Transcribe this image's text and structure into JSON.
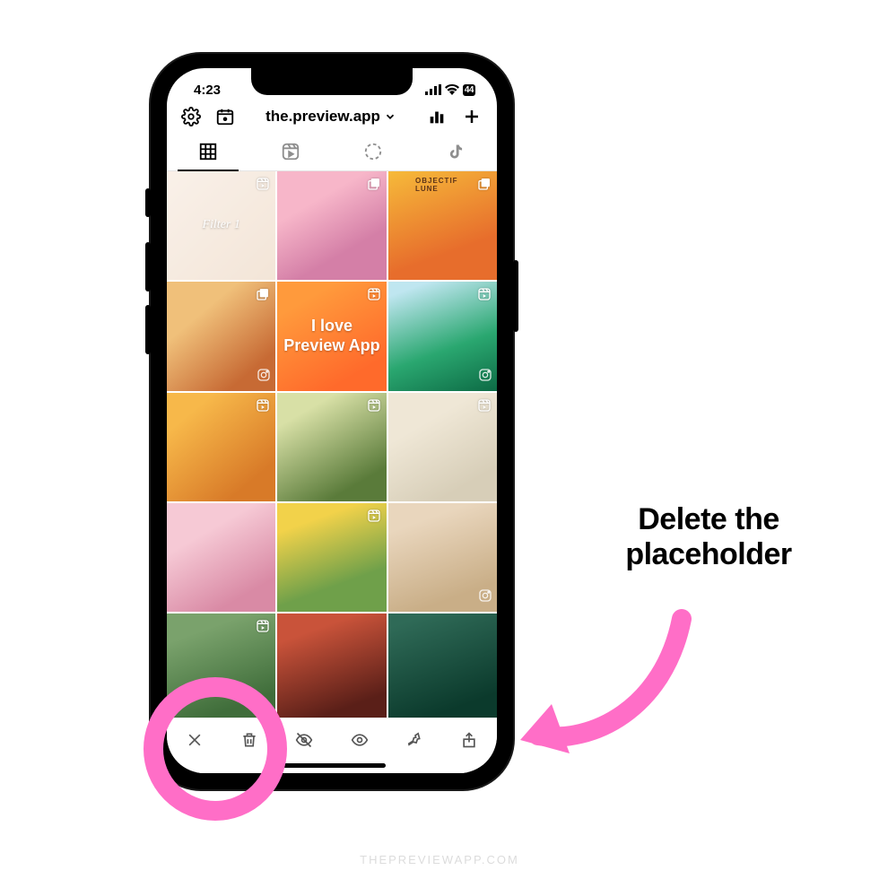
{
  "status": {
    "time": "4:23",
    "battery": "44"
  },
  "topbar": {
    "settings_icon": "settings",
    "calendar_icon": "calendar",
    "account": "the.preview.app",
    "analytics_icon": "analytics",
    "add_icon": "add"
  },
  "tabs": [
    {
      "name": "grid",
      "active": true
    },
    {
      "name": "reels",
      "active": false
    },
    {
      "name": "stories",
      "active": false
    },
    {
      "name": "tiktok",
      "active": false
    }
  ],
  "grid": [
    {
      "badge": "reel",
      "label": "Filter 1",
      "label_style": "italic",
      "selected": true,
      "bg": "bg-a"
    },
    {
      "badge": "carousel",
      "label": "",
      "label_style": "",
      "selected": false,
      "bg": "bg-b"
    },
    {
      "badge": "carousel",
      "label": "",
      "label_style": "",
      "selected": false,
      "bg": "bg-c"
    },
    {
      "badge": "carousel",
      "label": "",
      "label_style": "",
      "selected": false,
      "bg": "bg-d",
      "ig": true
    },
    {
      "badge": "reel",
      "label": "I love Preview App",
      "label_style": "bold",
      "selected": false,
      "bg": "bg-e"
    },
    {
      "badge": "reel",
      "label": "",
      "label_style": "",
      "selected": false,
      "bg": "bg-f",
      "ig": true
    },
    {
      "badge": "reel",
      "label": "",
      "label_style": "",
      "selected": false,
      "bg": "bg-g"
    },
    {
      "badge": "reel",
      "label": "",
      "label_style": "",
      "selected": false,
      "bg": "bg-h"
    },
    {
      "badge": "reel",
      "label": "",
      "label_style": "",
      "selected": false,
      "bg": "bg-i"
    },
    {
      "badge": "",
      "label": "",
      "label_style": "",
      "selected": false,
      "bg": "bg-j"
    },
    {
      "badge": "reel",
      "label": "",
      "label_style": "",
      "selected": false,
      "bg": "bg-k"
    },
    {
      "badge": "",
      "label": "",
      "label_style": "",
      "selected": false,
      "bg": "bg-l",
      "ig": true
    },
    {
      "badge": "reel",
      "label": "",
      "label_style": "",
      "selected": false,
      "bg": "bg-m"
    },
    {
      "badge": "",
      "label": "",
      "label_style": "",
      "selected": false,
      "bg": "bg-n"
    },
    {
      "badge": "",
      "label": "",
      "label_style": "",
      "selected": false,
      "bg": "bg-o"
    }
  ],
  "actions": {
    "close": "close",
    "delete": "delete",
    "hide": "hide",
    "show": "show",
    "pin": "pin",
    "share": "share"
  },
  "annotation": {
    "text": "Delete the placeholder",
    "watermark": "THEPREVIEWAPP.COM"
  }
}
